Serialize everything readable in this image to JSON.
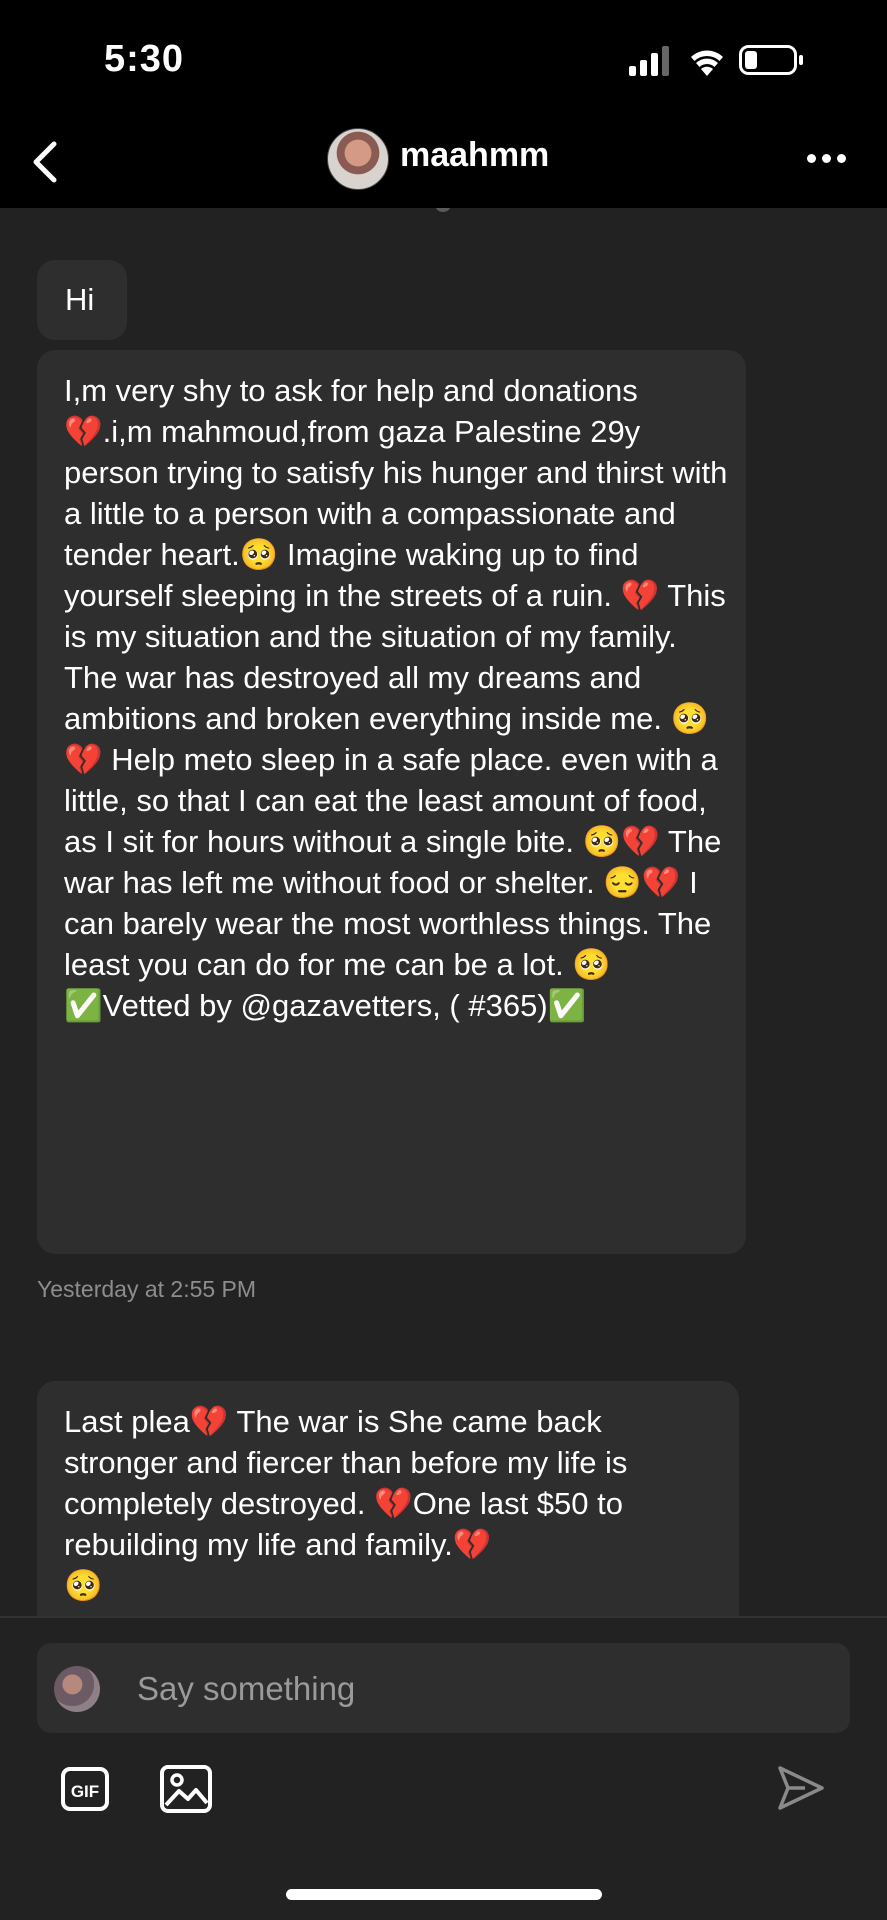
{
  "status_bar": {
    "time": "5:30"
  },
  "header": {
    "username": "maahmm",
    "back_icon": "chevron-left-icon",
    "more_icon": "more-horizontal-icon"
  },
  "messages": [
    {
      "text": "Hi"
    },
    {
      "text": "I,m very shy to ask for help and donations 💔.i,m mahmoud,from gaza Palestine 29y person trying to satisfy his hunger and thirst with a little to a person with a compassionate and tender heart.🥺 Imagine waking up to find yourself sleeping in the streets of a ruin. 💔 This is my situation and the situation of my family. The war has destroyed all my dreams and ambitions and broken everything inside me. 🥺💔 Help meto sleep in a safe place. even with a little, so that I can eat the least amount of food, as I sit for hours without a single bite. 🥺💔 The war has left me without food or shelter. 😔💔 I can barely wear the most worthless things. The least you can do for me can be a lot. 🥺\n✅Vetted by @gazavetters, ( #365)✅"
    },
    {
      "text": "Last plea💔 The war is She came back stronger and fiercer than before my life is completely destroyed. 💔One last $50 to rebuilding my life and family.💔\n🥺"
    }
  ],
  "timestamp": "Yesterday at 2:55 PM",
  "composer": {
    "placeholder": "Say something",
    "gif_label": "GIF"
  },
  "colors": {
    "background": "#222222",
    "bubble": "#2e2e2e",
    "header": "#000000",
    "timestamp": "#8d8d8d"
  }
}
